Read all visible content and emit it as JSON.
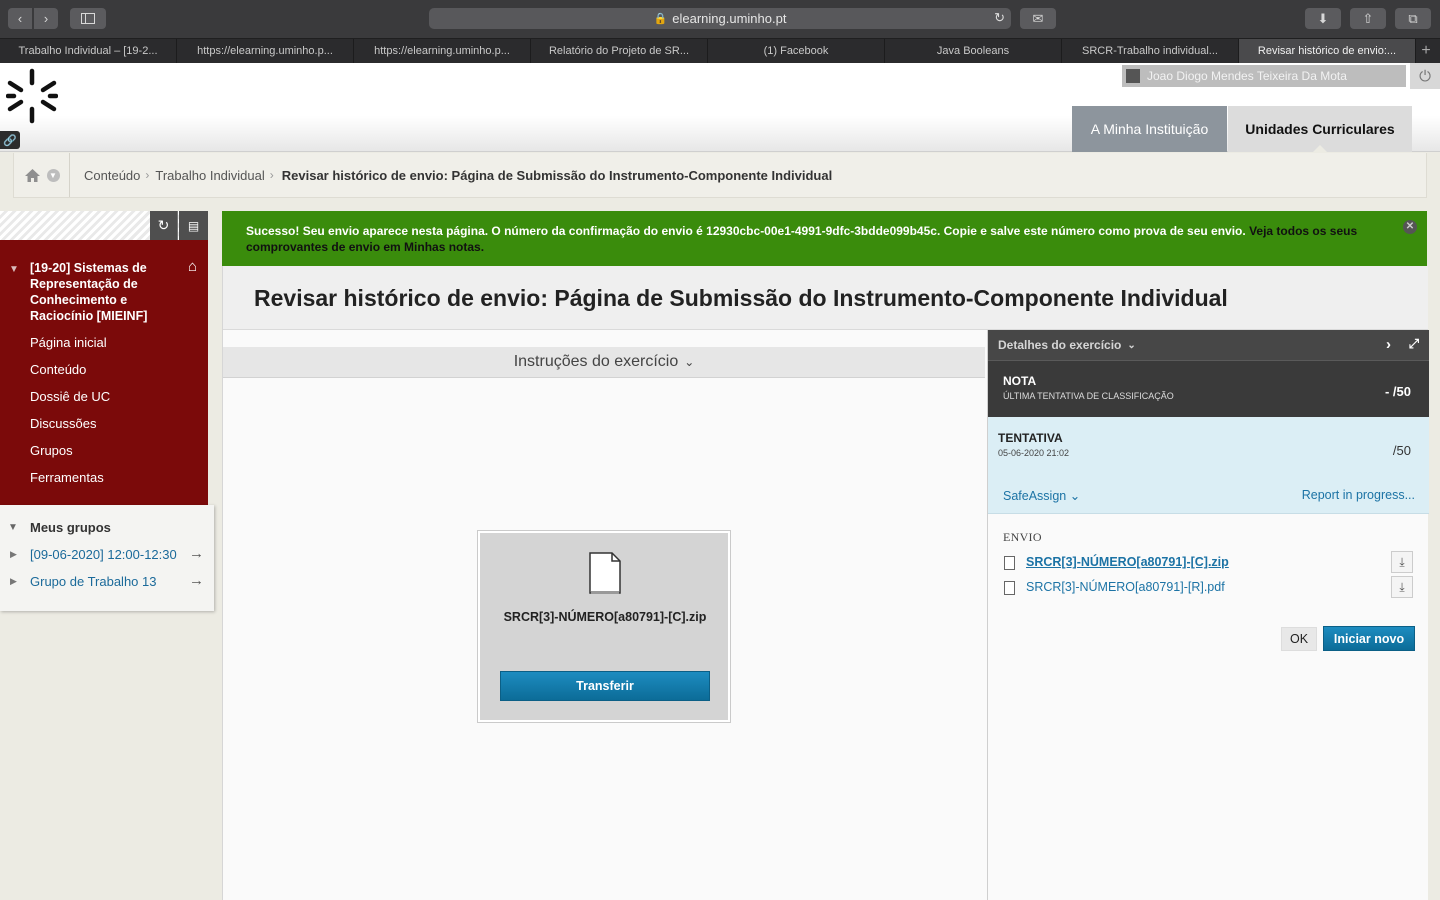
{
  "browser": {
    "url": "elearning.uminho.pt",
    "tabs": [
      {
        "label": "Trabalho Individual – [19-2..."
      },
      {
        "label": "https://elearning.uminho.p..."
      },
      {
        "label": "https://elearning.uminho.p..."
      },
      {
        "label": "Relatório do Projeto de SR..."
      },
      {
        "label": "(1) Facebook"
      },
      {
        "label": "Java Booleans"
      },
      {
        "label": "SRCR-Trabalho individual..."
      },
      {
        "label": "Revisar histórico de envio:..."
      }
    ],
    "active_tab_index": 7
  },
  "header": {
    "user_name": "Joao Diogo Mendes Teixeira Da Mota",
    "tab_institution": "A Minha Instituição",
    "tab_courses": "Unidades Curriculares"
  },
  "breadcrumb": {
    "items": [
      "Conteúdo",
      "Trabalho Individual"
    ],
    "current": "Revisar histórico de envio: Página de Submissão do Instrumento-Componente Individual"
  },
  "course_menu": {
    "title": "[19-20] Sistemas de Representação de Conhecimento e Raciocínio [MIEINF]",
    "links": [
      "Página inicial",
      "Conteúdo",
      "Dossiê de UC",
      "Discussões",
      "Grupos",
      "Ferramentas"
    ]
  },
  "groups": {
    "title": "Meus grupos",
    "items": [
      "[09-06-2020] 12:00-12:30",
      "Grupo de Trabalho 13"
    ]
  },
  "success": {
    "message": "Sucesso! Seu envio aparece nesta página. O número da confirmação do envio é 12930cbc-00e1-4991-9dfc-3bdde099b45c. Copie e salve este número como prova de seu envio.",
    "link": "Veja todos os seus comprovantes de envio em Minhas notas."
  },
  "main": {
    "title": "Revisar histórico de envio: Página de Submissão do Instrumento-Componente Individual",
    "instructions_label": "Instruções do exercício",
    "file_card": {
      "file_name": "SRCR[3]-NÚMERO[a80791]-[C].zip",
      "download_label": "Transferir"
    }
  },
  "details": {
    "header": "Detalhes do exercício",
    "nota_label": "NOTA",
    "nota_sub": "ÚLTIMA TENTATIVA DE CLASSIFICAÇÃO",
    "nota_score": "- /50",
    "tentativa_label": "TENTATIVA",
    "tentativa_date": "05-06-2020 21:02",
    "tentativa_score": "/50",
    "safeassign": "SafeAssign",
    "report": "Report in progress...",
    "envio_label": "ENVIO",
    "files": [
      "SRCR[3]-NÚMERO[a80791]-[C].zip",
      "SRCR[3]-NÚMERO[a80791]-[R].pdf"
    ],
    "ok_label": "OK",
    "new_label": "Iniciar novo"
  },
  "colors": {
    "course_menu_bg": "#7b0a0a",
    "success_bg": "#3a8c0c",
    "primary_button": "#1d8cc0",
    "link": "#1c73a5"
  }
}
